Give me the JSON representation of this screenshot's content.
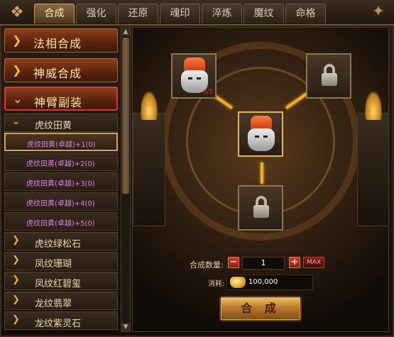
{
  "tabs": [
    {
      "label": "合成",
      "active": true
    },
    {
      "label": "强化"
    },
    {
      "label": "还原"
    },
    {
      "label": "魂印"
    },
    {
      "label": "淬炼"
    },
    {
      "label": "魔纹"
    },
    {
      "label": "命格"
    }
  ],
  "categories": [
    {
      "label": "法相合成",
      "open": false
    },
    {
      "label": "神威合成",
      "open": false
    },
    {
      "label": "神臂副装",
      "open": true
    }
  ],
  "open_subcategory": {
    "label": "虎纹田黄"
  },
  "items": [
    {
      "label": "虎纹田黄(卓越)+1(0)",
      "selected": true
    },
    {
      "label": "虎纹田黄(卓越)+2(0)"
    },
    {
      "label": "虎纹田黄(卓越)+3(0)"
    },
    {
      "label": "虎纹田黄(卓越)+4(0)"
    },
    {
      "label": "虎纹田黄(卓越)+5(0)"
    }
  ],
  "subcategories": [
    {
      "label": "虎纹绿松石"
    },
    {
      "label": "凤纹珊瑚"
    },
    {
      "label": "凤纹红碧玺"
    },
    {
      "label": "龙纹翡翠"
    },
    {
      "label": "龙纹紫灵石"
    }
  ],
  "slots": {
    "material_count": "0/3"
  },
  "quantity": {
    "label": "合成数量:",
    "value": "1",
    "minus": "−",
    "plus": "+",
    "max": "MAX"
  },
  "cost": {
    "label": "消耗:",
    "value": "100,000",
    "icon": "gold-ingot-icon"
  },
  "combine_button": "合 成",
  "colors": {
    "accent_gold": "#f0a92a",
    "item_text": "#d884e3",
    "category_text": "#f7e2a8",
    "selected_border": "#e0323a"
  }
}
